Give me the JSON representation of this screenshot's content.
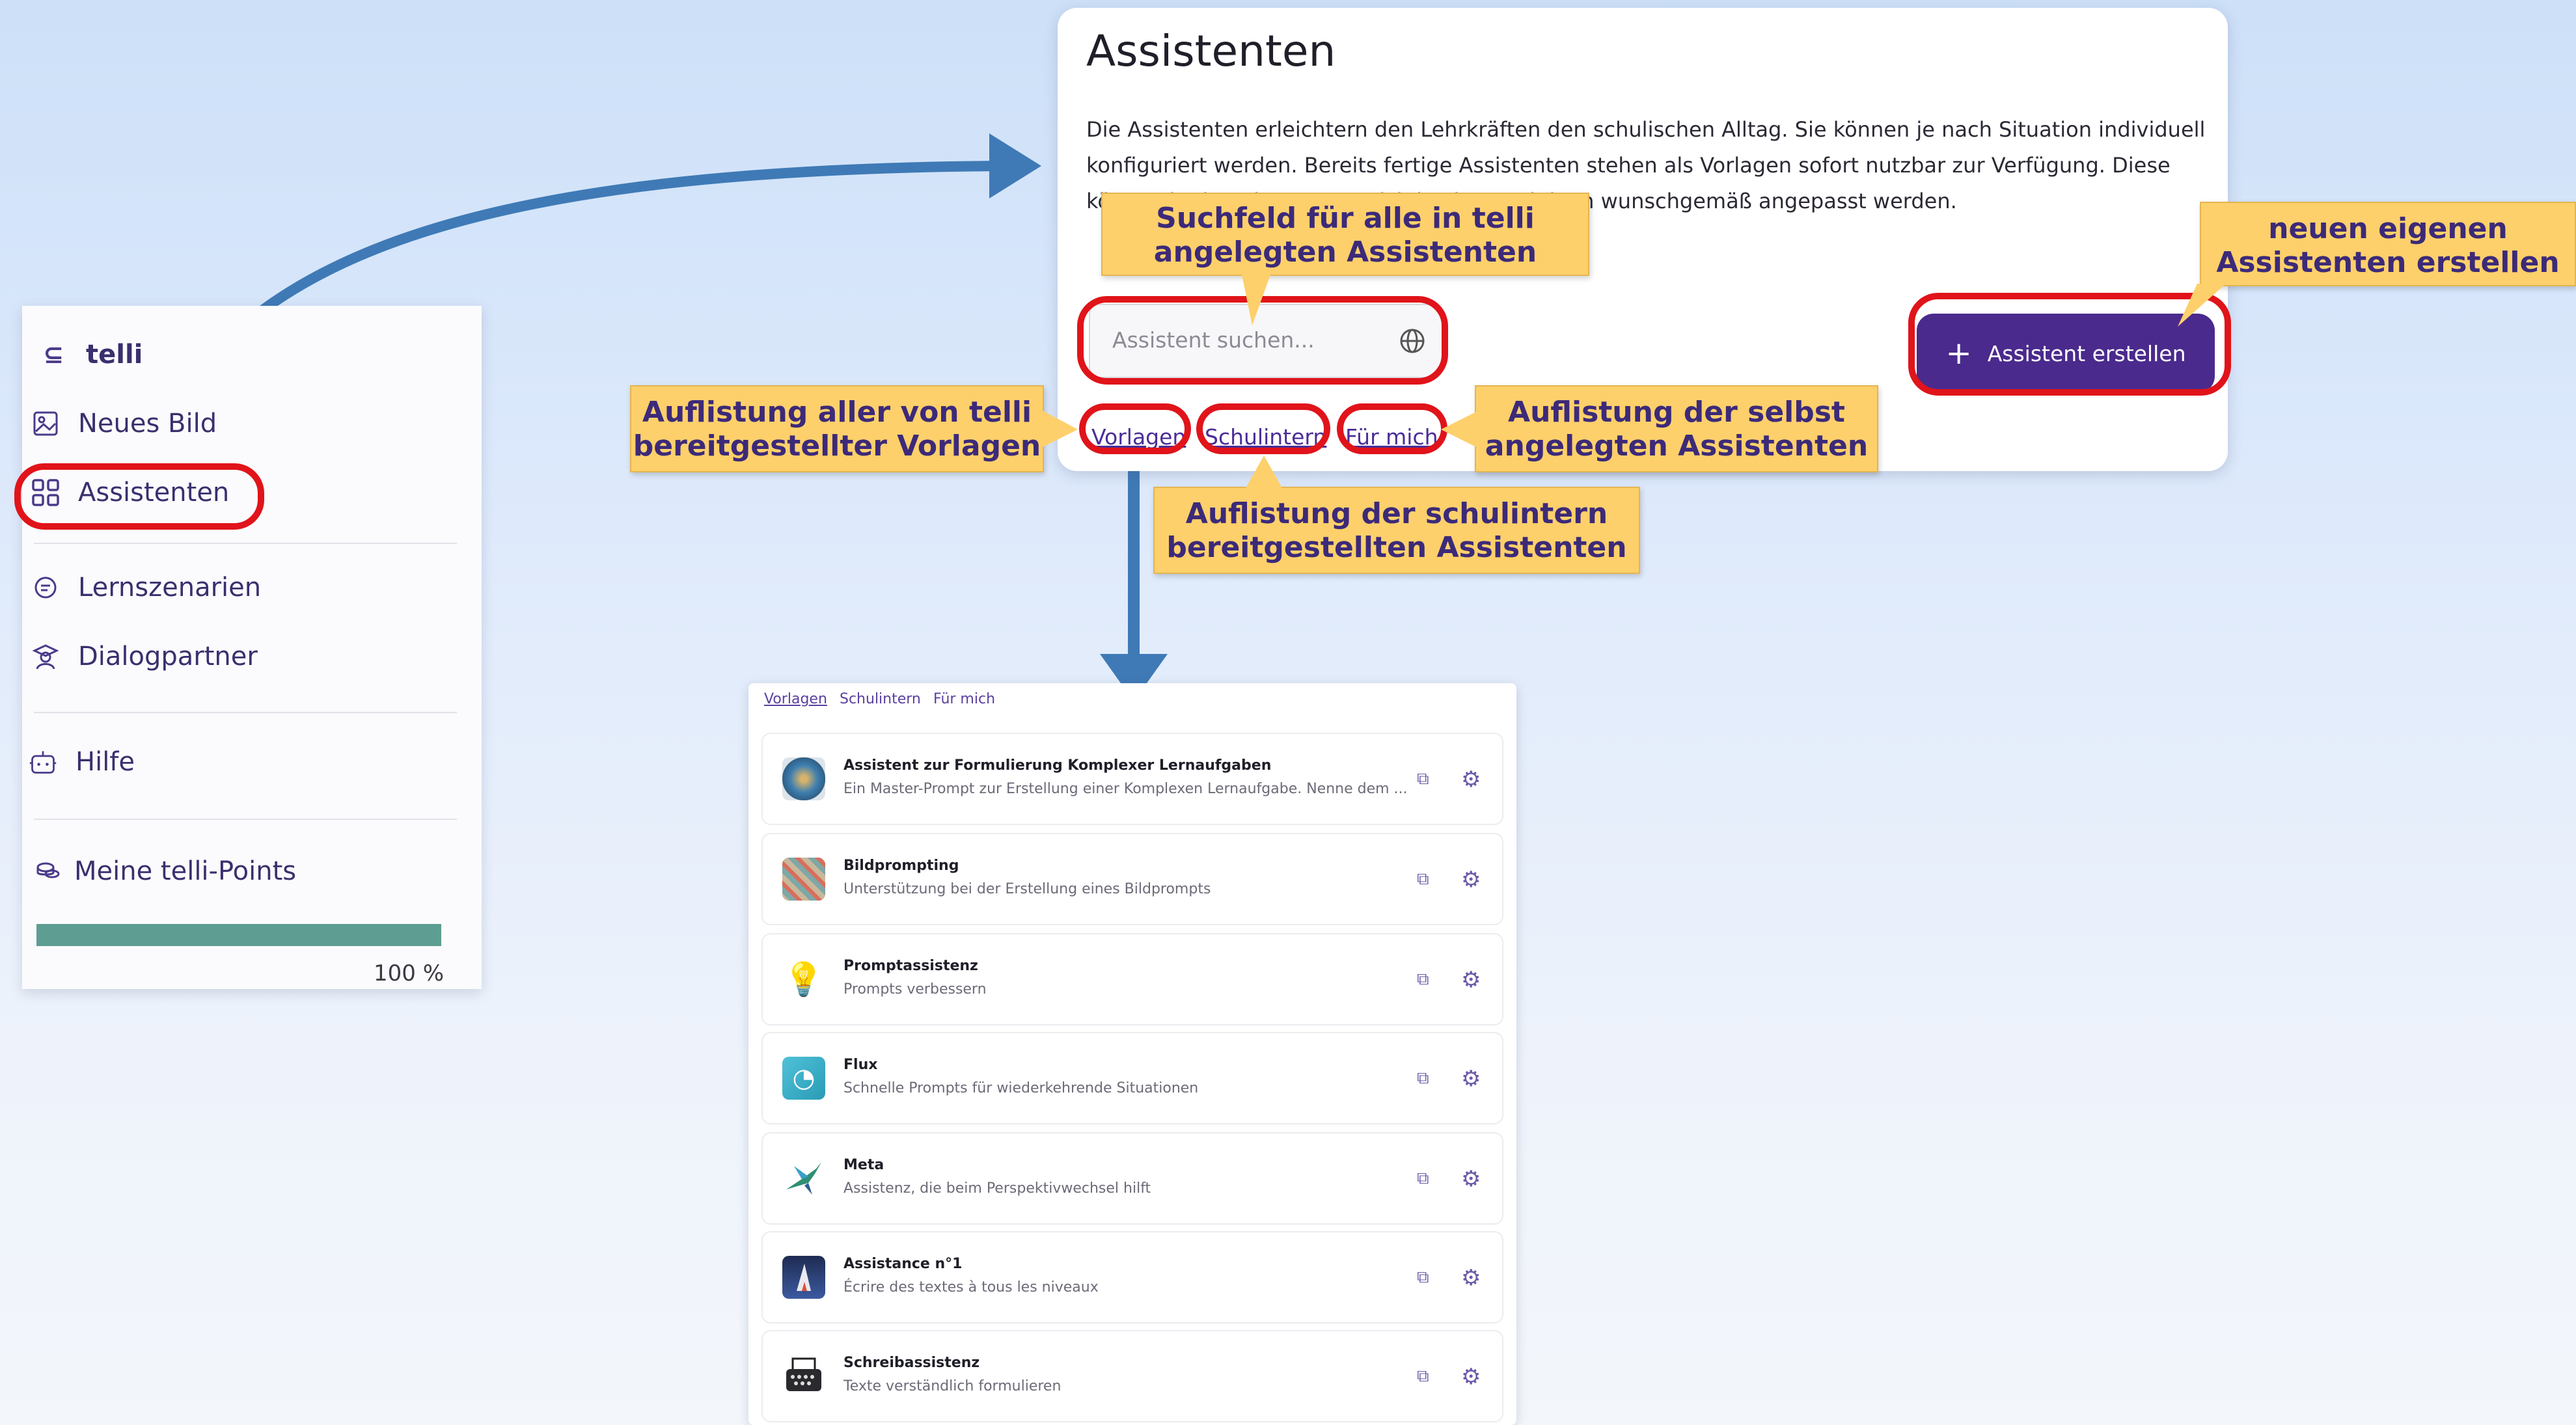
{
  "sidebar": {
    "brand": "telli",
    "items": [
      {
        "label": "Neues Bild",
        "icon": "image-icon"
      },
      {
        "label": "Assistenten",
        "icon": "grid-icon"
      },
      {
        "label": "Lernszenarien",
        "icon": "chat-icon"
      },
      {
        "label": "Dialogpartner",
        "icon": "teacher-icon"
      },
      {
        "label": "Hilfe",
        "icon": "robot-icon"
      },
      {
        "label": "Meine telli-Points",
        "icon": "coins-icon"
      }
    ],
    "points_percent": "100 %",
    "points_fraction": 1.0
  },
  "panel": {
    "title": "Assistenten",
    "description": "Die Assistenten erleichtern den Lehrkräften den schulischen Alltag. Sie können je nach Situation individuell konfiguriert werden. Bereits fertige Assistenten stehen als Vorlagen sofort nutzbar zur Verfügung. Diese können in den eigenen Bereich kopiert und dann wunschgemäß angepasst werden.",
    "search_placeholder": "Assistent suchen...",
    "create_label": "Assistent erstellen",
    "tabs": [
      "Vorlagen",
      "Schulintern",
      "Für mich"
    ]
  },
  "callouts": {
    "search": "Suchfeld für alle in telli angelegten Assistenten",
    "create": "neuen eigenen Assistenten erstellen",
    "vorlagen": "Auflistung aller von  telli bereitgestellter Vorlagen",
    "fuer_mich": "Auflistung der selbst angelegten Assistenten",
    "schulintern": "Auflistung der schulintern bereitgestellten Assistenten"
  },
  "list": {
    "tabs": [
      "Vorlagen",
      "Schulintern",
      "Für mich"
    ],
    "items": [
      {
        "name": "Assistent zur Formulierung Komplexer Lernaufgaben",
        "desc": "Ein Master-Prompt zur Erstellung einer Komplexen Lernaufgabe. Nenne dem ..."
      },
      {
        "name": "Bildprompting",
        "desc": "Unterstützung bei der Erstellung eines Bildprompts"
      },
      {
        "name": "Promptassistenz",
        "desc": "Prompts verbessern"
      },
      {
        "name": "Flux",
        "desc": "Schnelle Prompts für wiederkehrende Situationen"
      },
      {
        "name": "Meta",
        "desc": "Assistenz, die beim Perspektivwechsel hilft"
      },
      {
        "name": "Assistance n°1",
        "desc": "Écrire des textes à tous les niveaux"
      },
      {
        "name": "Schreibassistenz",
        "desc": "Texte verständlich formulieren"
      }
    ]
  },
  "colors": {
    "accent": "#4a2a8c",
    "highlight": "#e0141a",
    "callout": "#fdd06b",
    "arrow": "#3f7ab6",
    "progress": "#5e9e92"
  }
}
